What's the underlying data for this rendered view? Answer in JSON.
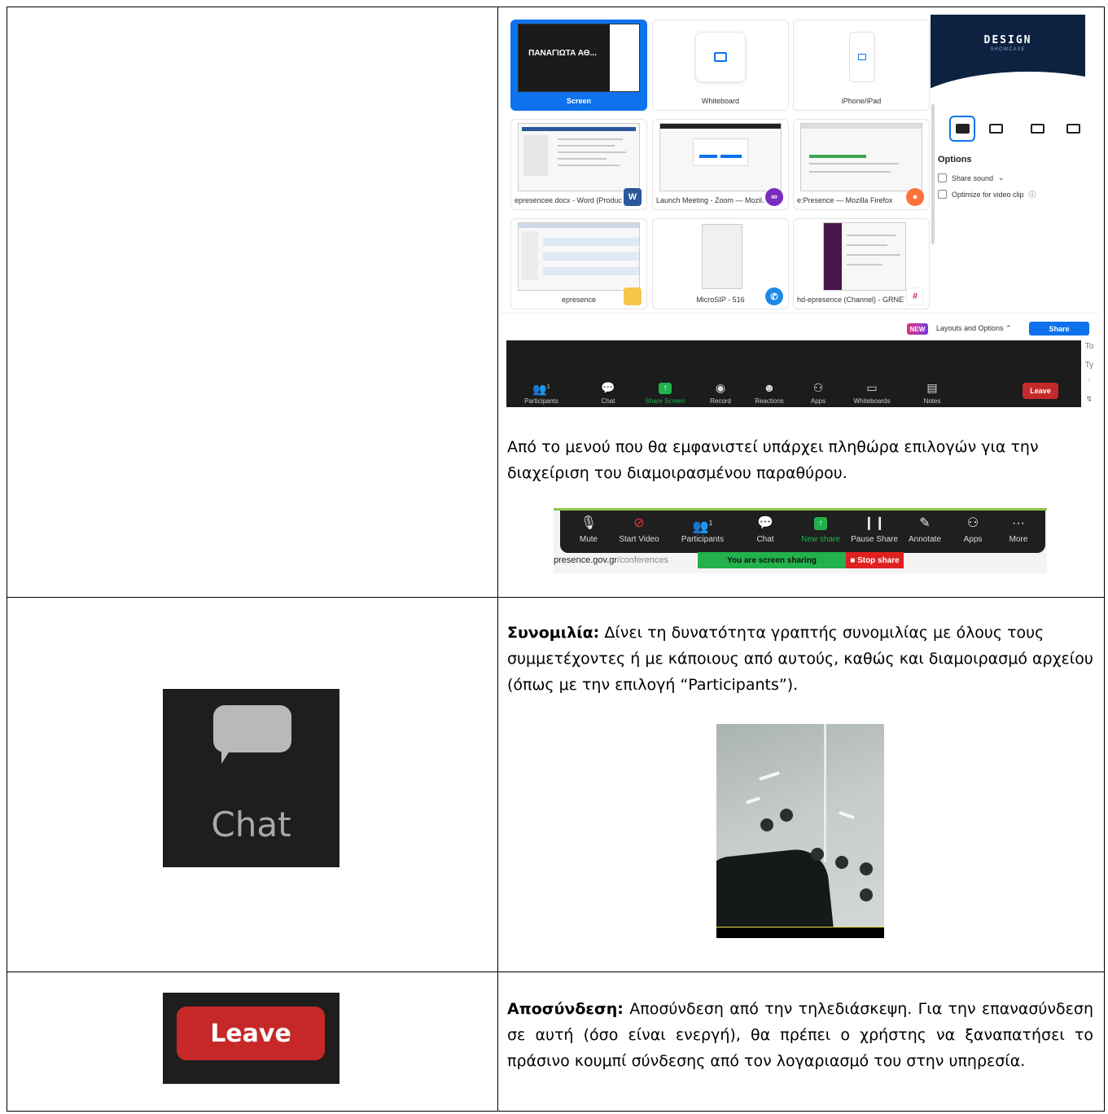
{
  "share_picker": {
    "tiles": [
      {
        "label": "Screen",
        "thumb_text": "ΠΑΝΑΓΙΩΤΑ ΑΘ..."
      },
      {
        "label": "Whiteboard"
      },
      {
        "label": "iPhone/iPad"
      },
      {
        "label": "epresencee.docx - Word (Product...",
        "badge": "W"
      },
      {
        "label": "Launch Meeting - Zoom — Mozil..."
      },
      {
        "label": "e:Presence — Mozilla Firefox"
      },
      {
        "label": "epresence"
      },
      {
        "label": "MicroSIP - 516"
      },
      {
        "label": "hd-epresence (Channel) - GRNET ..."
      }
    ],
    "preview_title": "DESIGN",
    "preview_subtitle": "SHOWCASE",
    "options_title": "Options",
    "option_share_sound": "Share sound",
    "option_optimize": "Optimize for video clip",
    "new_badge": "NEW",
    "layouts_link": "Layouts and Options",
    "share_button": "Share",
    "toolbar": {
      "participants": "Participants",
      "participants_count": "1",
      "chat": "Chat",
      "share_screen": "Share Screen",
      "record": "Record",
      "reactions": "Reactions",
      "apps": "Apps",
      "whiteboards": "Whiteboards",
      "notes": "Notes",
      "leave": "Leave"
    },
    "side_chars": [
      "To",
      "Ty",
      "ⁱ",
      "↯"
    ]
  },
  "text": {
    "share_paragraph": "Από το μενού που θα εμφανιστεί υπάρχει πληθώρα επιλογών για την διαχείριση του διαμοιρασμένου παραθύρου.",
    "chat_title": "Συνομιλία:",
    "chat_body": " Δίνει τη δυνατότητα γραπτής συνομιλίας με όλους τους συμμετέχοντες ή με κάποιους από αυτούς, καθώς και διαμοιρασμό αρχείου (όπως με την επιλογή “Participants”).",
    "leave_title": "Αποσύνδεση:",
    "leave_body": " Αποσύνδεση από την τηλεδιάσκεψη. Για την επανασύνδεση σε αυτή (όσο είναι ενεργή), θα πρέπει ο χρήστης να ξαναπατήσει το πράσινο κουμπί σύνδεσης από τον λογαριασμό του στην υπηρεσία."
  },
  "meeting_bar": {
    "mute": "Mute",
    "start_video": "Start Video",
    "participants": "Participants",
    "participants_count": "1",
    "chat": "Chat",
    "new_share": "New share",
    "pause_share": "Pause Share",
    "annotate": "Annotate",
    "apps": "Apps",
    "more": "More",
    "url_host": "presence.gov.gr",
    "url_path": "/conferences",
    "sharing_banner": "You are screen sharing",
    "stop_share": "Stop share"
  },
  "chat_crop": {
    "word": "Chat"
  },
  "leave_crop": {
    "label": "Leave"
  }
}
